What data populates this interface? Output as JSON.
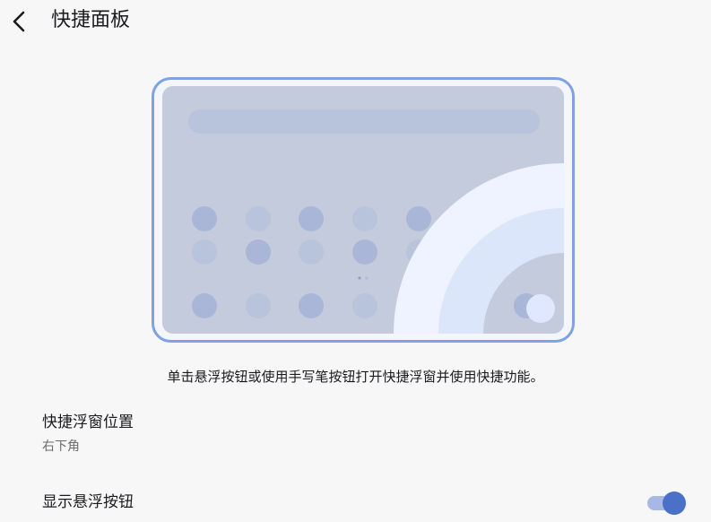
{
  "header": {
    "title": "快捷面板",
    "back_icon": "chevron-left-icon"
  },
  "preview": {
    "description": "单击悬浮按钮或使用手写笔按钮打开快捷浮窗并使用快捷功能。",
    "colors": {
      "frame": "#7fa2e3",
      "screen": "#c3cbdc",
      "search_bar": "#b8c4dc",
      "app_dot": "#a9b6d8",
      "arc_outer": "#eef3ff",
      "arc_middle": "#dce6fb",
      "float_button": "#dfe8ff"
    }
  },
  "settings": {
    "position": {
      "title": "快捷浮窗位置",
      "value": "右下角"
    },
    "show_float_button": {
      "title": "显示悬浮按钮",
      "enabled": true
    }
  },
  "theme": {
    "accent": "#4a70c8",
    "background": "#f7f7f8"
  }
}
